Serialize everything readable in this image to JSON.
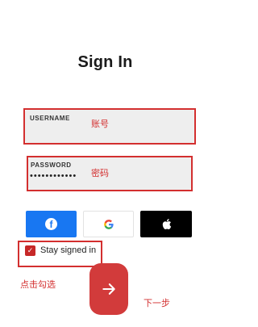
{
  "page": {
    "title": "Sign In"
  },
  "form": {
    "username": {
      "label": "USERNAME",
      "value": "",
      "annotation": "账号"
    },
    "password": {
      "label": "PASSWORD",
      "value": "••••••••••••",
      "annotation": "密码"
    }
  },
  "social": {
    "facebook_icon": "facebook-icon",
    "google_icon": "google-icon",
    "apple_icon": "apple-icon"
  },
  "stay_signed_in": {
    "label": "Stay signed in",
    "checked": true,
    "annotation": "点击勾选"
  },
  "next": {
    "icon": "arrow-right-icon",
    "annotation": "下一步"
  },
  "colors": {
    "annotation_red": "#d32f2f",
    "facebook_blue": "#1877f2",
    "apple_black": "#000000",
    "next_button": "#d23b3b"
  }
}
